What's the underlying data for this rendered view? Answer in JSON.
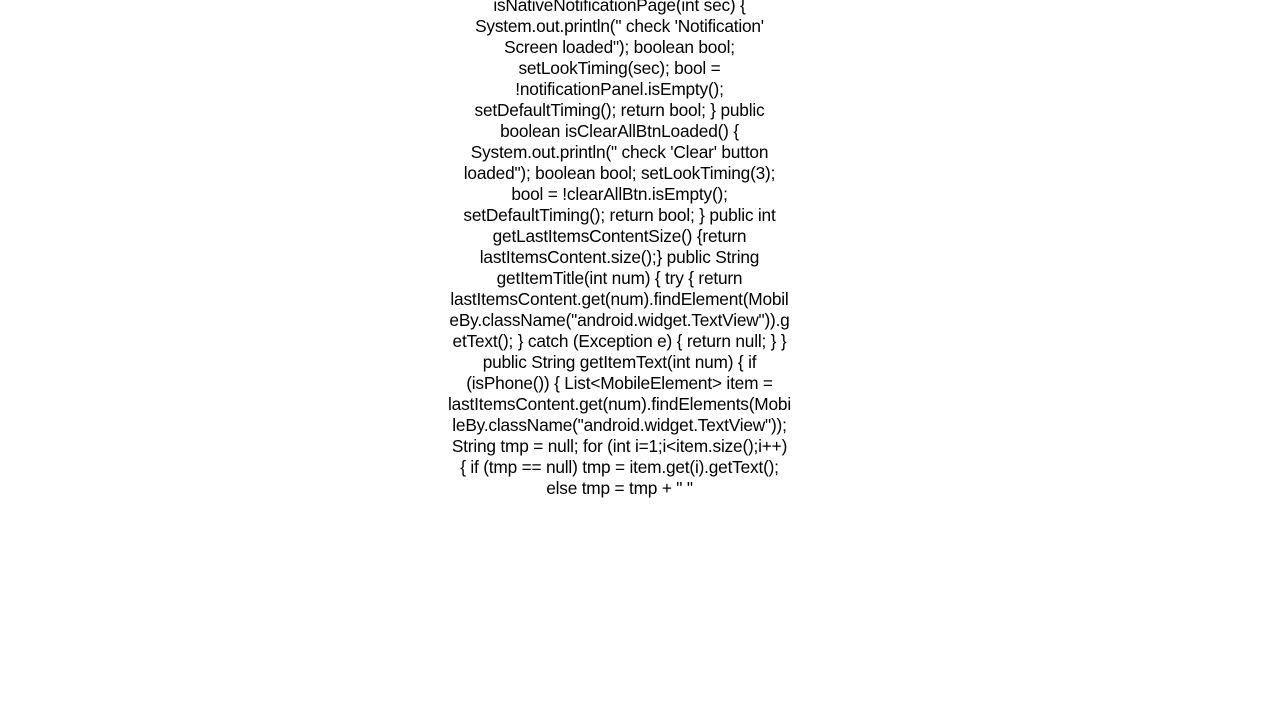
{
  "code_text": "isNativeNotificationPage(int sec) {         System.out.println(\"   check 'Notification' Screen loaded\");         boolean bool;         setLookTiming(sec);         bool = !notificationPanel.isEmpty();         setDefaultTiming();         return bool;     }      public boolean isClearAllBtnLoaded() {         System.out.println(\"   check 'Clear' button loaded\");         boolean bool;         setLookTiming(3);         bool = !clearAllBtn.isEmpty();         setDefaultTiming();         return bool;     }      public int getLastItemsContentSize() {return lastItemsContent.size();}      public String getItemTitle(int num) {         try {             return lastItemsContent.get(num).findElement(MobileBy.className(\"android.widget.TextView\")).getText();         } catch (Exception e) {             return null;         }     }      public String getItemText(int num) {         if (isPhone()) {             List<MobileElement> item = lastItemsContent.get(num).findElements(MobileBy.className(\"android.widget.TextView\"));             String tmp = null;             for (int i=1;i<item.size();i++) {                 if (tmp == null)                     tmp = item.get(i).getText();                 else                     tmp = tmp + \" \""
}
